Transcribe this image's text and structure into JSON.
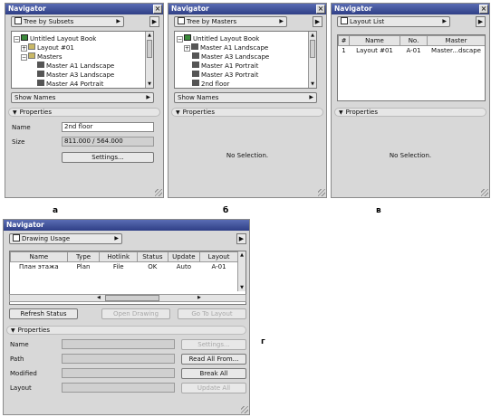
{
  "panel_a": {
    "title": "Navigator",
    "view_select": "Tree by Subsets",
    "tree": [
      "Untitled Layout Book",
      "Layout #01",
      "Masters",
      "Master A1 Landscape",
      "Master A3 Landscape",
      "Master A4 Portrait"
    ],
    "show_names": "Show Names",
    "properties": "Properties",
    "name_label": "Name",
    "name_value": "2nd floor",
    "size_label": "Size",
    "size_value": "811.000 / 564.000",
    "settings_btn": "Settings..."
  },
  "panel_b": {
    "title": "Navigator",
    "view_select": "Tree by Masters",
    "tree": [
      "Untitled Layout Book",
      "Master A1 Landscape",
      "Master A3 Landscape",
      "Master A1 Portrait",
      "Master A3 Portrait",
      "2nd floor"
    ],
    "show_names": "Show Names",
    "properties": "Properties",
    "no_selection": "No Selection."
  },
  "panel_c": {
    "title": "Navigator",
    "view_select": "Layout List",
    "headers": [
      "#",
      "Name",
      "No.",
      "Master"
    ],
    "row": [
      "1",
      "Layout #01",
      "A-01",
      "Master...dscape"
    ],
    "properties": "Properties",
    "no_selection": "No Selection."
  },
  "panel_d": {
    "title": "Navigator",
    "view_select": "Drawing Usage",
    "headers": [
      "Name",
      "Type",
      "Hotlink",
      "Status",
      "Update",
      "Layout"
    ],
    "row": [
      "План этажа",
      "Plan",
      "File",
      "OK",
      "Auto",
      "A-01"
    ],
    "refresh_btn": "Refresh Status",
    "open_drawing_btn": "Open Drawing",
    "go_to_layout_btn": "Go To Layout",
    "properties": "Properties",
    "name_label": "Name",
    "path_label": "Path",
    "modified_label": "Modified",
    "layout_label": "Layout",
    "settings_btn": "Settings...",
    "read_all_btn": "Read All From...",
    "break_all_btn": "Break All",
    "update_all_btn": "Update All"
  },
  "captions": [
    "а",
    "б",
    "в",
    "г"
  ]
}
